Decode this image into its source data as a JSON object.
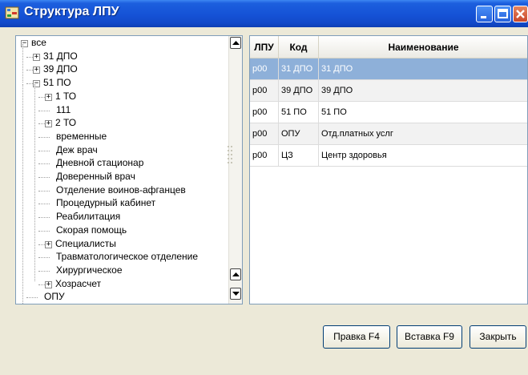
{
  "window": {
    "title": "Структура ЛПУ"
  },
  "tree": {
    "nodes": [
      {
        "label": "все",
        "expander": "−"
      },
      {
        "label": "31 ДПО",
        "expander": "+"
      },
      {
        "label": "39 ДПО",
        "expander": "+"
      },
      {
        "label": "51 ПО",
        "expander": "−"
      },
      {
        "label": "1 ТО",
        "expander": "+"
      },
      {
        "label": "111",
        "expander": ""
      },
      {
        "label": "2 ТО",
        "expander": "+"
      },
      {
        "label": "временные",
        "expander": ""
      },
      {
        "label": "Деж врач",
        "expander": ""
      },
      {
        "label": "Дневной стационар",
        "expander": ""
      },
      {
        "label": "Доверенный врач",
        "expander": ""
      },
      {
        "label": "Отделение воинов-афганцев",
        "expander": ""
      },
      {
        "label": "Процедурный кабинет",
        "expander": ""
      },
      {
        "label": "Реабилитация",
        "expander": ""
      },
      {
        "label": "Скорая помощь",
        "expander": ""
      },
      {
        "label": "Специалисты",
        "expander": "+"
      },
      {
        "label": "Травматологическое отделение",
        "expander": ""
      },
      {
        "label": "Хирургическое",
        "expander": ""
      },
      {
        "label": "Хозрасчет",
        "expander": "+"
      },
      {
        "label": "ОПУ",
        "expander": ""
      }
    ]
  },
  "grid": {
    "columns": [
      "ЛПУ",
      "Код",
      "Наименование"
    ],
    "rows": [
      [
        "р00",
        "31 ДПО",
        "31 ДПО"
      ],
      [
        "р00",
        "39 ДПО",
        "39 ДПО"
      ],
      [
        "р00",
        "51 ПО",
        "51 ПО"
      ],
      [
        "р00",
        "ОПУ",
        "Отд.платных услг"
      ],
      [
        "р00",
        "ЦЗ",
        "Центр здоровья"
      ]
    ]
  },
  "buttons": {
    "edit": "Правка F4",
    "insert": "Вставка F9",
    "close": "Закрыть"
  },
  "icons": {
    "app": "tree-structure-icon",
    "minimize": "minimize-icon",
    "maximize": "maximize-icon",
    "close": "close-icon"
  },
  "colors": {
    "titlebar": "#1552d6",
    "selection": "#8eb0d9",
    "close_button": "#c9472b"
  }
}
